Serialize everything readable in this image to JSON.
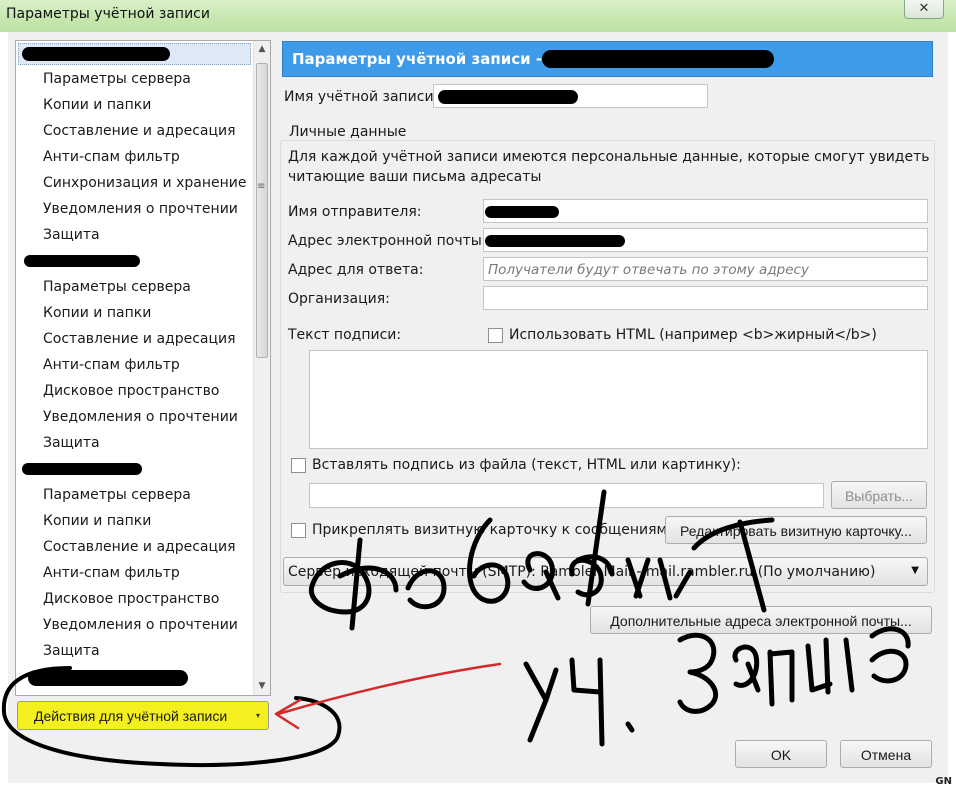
{
  "window": {
    "title": "Параметры учётной записи",
    "close_glyph": "✕"
  },
  "tree": {
    "accounts": [
      {
        "items": [
          "Параметры сервера",
          "Копии и папки",
          "Составление и адресация",
          "Анти-спам фильтр",
          "Синхронизация и хранение",
          "Уведомления о прочтении",
          "Защита"
        ]
      },
      {
        "items": [
          "Параметры сервера",
          "Копии и папки",
          "Составление и адресация",
          "Анти-спам фильтр",
          "Дисковое пространство",
          "Уведомления о прочтении",
          "Защита"
        ]
      },
      {
        "items": [
          "Параметры сервера",
          "Копии и папки",
          "Составление и адресация",
          "Анти-спам фильтр",
          "Дисковое пространство",
          "Уведомления о прочтении",
          "Защита"
        ]
      }
    ],
    "scroll_up": "▲",
    "scroll_down": "▼",
    "grip": "≡"
  },
  "account_actions": {
    "label": "Действия для учётной записи",
    "caret": "▾"
  },
  "panel": {
    "header": "Параметры учётной записи -",
    "account_name_label": "Имя учётной записи:",
    "personal": {
      "legend": "Личные данные",
      "description_line1": "Для каждой учётной записи имеются персональные данные, которые смогут увидеть",
      "description_line2": "читающие ваши письма адресаты",
      "sender_name_label": "Имя отправителя:",
      "email_label": "Адрес электронной почты:",
      "reply_to_label": "Адрес для ответа:",
      "reply_to_placeholder": "Получатели будут отвечать по этому адресу",
      "organization_label": "Организация:",
      "signature_label": "Текст подписи:",
      "use_html_label": "Использовать HTML (например <b>жирный</b>)",
      "attach_signature_label": "Вставлять подпись из файла (текст, HTML или картинку):",
      "choose_button": "Выбрать...",
      "vcard_label": "Прикреплять визитную карточку к сообщениям",
      "edit_vcard_button": "Редактировать визитную карточку...",
      "smtp_value": "Сервер исходящей почты (SMTP): Rambler Mail - mail.rambler.ru (По умолчанию)",
      "smtp_caret": "▼"
    },
    "additional_addresses_button": "Дополнительные адреса электронной почты..."
  },
  "footer": {
    "ok": "OK",
    "cancel": "Отмена"
  },
  "watermark": "GN",
  "colors": {
    "header_bg": "#3d9be9",
    "highlight": "#f4ef1e",
    "annotation_red": "#d42a2a",
    "titlebar": "#c6e6ae"
  }
}
